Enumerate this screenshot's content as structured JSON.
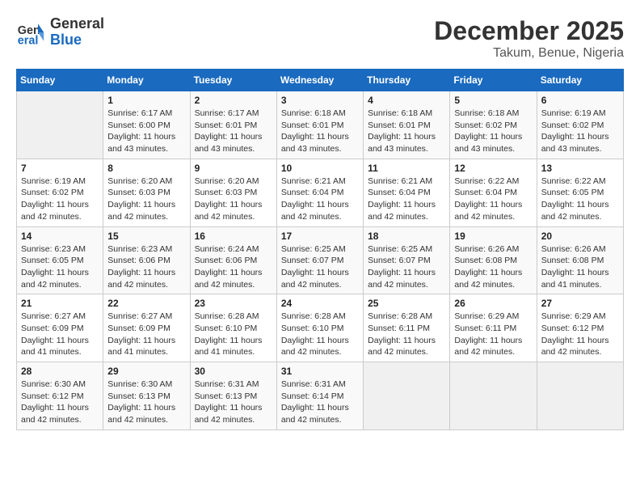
{
  "header": {
    "logo_line1": "General",
    "logo_line2": "Blue",
    "title": "December 2025",
    "subtitle": "Takum, Benue, Nigeria"
  },
  "calendar": {
    "days_of_week": [
      "Sunday",
      "Monday",
      "Tuesday",
      "Wednesday",
      "Thursday",
      "Friday",
      "Saturday"
    ],
    "weeks": [
      [
        {
          "day": "",
          "info": ""
        },
        {
          "day": "1",
          "info": "Sunrise: 6:17 AM\nSunset: 6:00 PM\nDaylight: 11 hours\nand 43 minutes."
        },
        {
          "day": "2",
          "info": "Sunrise: 6:17 AM\nSunset: 6:01 PM\nDaylight: 11 hours\nand 43 minutes."
        },
        {
          "day": "3",
          "info": "Sunrise: 6:18 AM\nSunset: 6:01 PM\nDaylight: 11 hours\nand 43 minutes."
        },
        {
          "day": "4",
          "info": "Sunrise: 6:18 AM\nSunset: 6:01 PM\nDaylight: 11 hours\nand 43 minutes."
        },
        {
          "day": "5",
          "info": "Sunrise: 6:18 AM\nSunset: 6:02 PM\nDaylight: 11 hours\nand 43 minutes."
        },
        {
          "day": "6",
          "info": "Sunrise: 6:19 AM\nSunset: 6:02 PM\nDaylight: 11 hours\nand 43 minutes."
        }
      ],
      [
        {
          "day": "7",
          "info": "Sunrise: 6:19 AM\nSunset: 6:02 PM\nDaylight: 11 hours\nand 42 minutes."
        },
        {
          "day": "8",
          "info": "Sunrise: 6:20 AM\nSunset: 6:03 PM\nDaylight: 11 hours\nand 42 minutes."
        },
        {
          "day": "9",
          "info": "Sunrise: 6:20 AM\nSunset: 6:03 PM\nDaylight: 11 hours\nand 42 minutes."
        },
        {
          "day": "10",
          "info": "Sunrise: 6:21 AM\nSunset: 6:04 PM\nDaylight: 11 hours\nand 42 minutes."
        },
        {
          "day": "11",
          "info": "Sunrise: 6:21 AM\nSunset: 6:04 PM\nDaylight: 11 hours\nand 42 minutes."
        },
        {
          "day": "12",
          "info": "Sunrise: 6:22 AM\nSunset: 6:04 PM\nDaylight: 11 hours\nand 42 minutes."
        },
        {
          "day": "13",
          "info": "Sunrise: 6:22 AM\nSunset: 6:05 PM\nDaylight: 11 hours\nand 42 minutes."
        }
      ],
      [
        {
          "day": "14",
          "info": "Sunrise: 6:23 AM\nSunset: 6:05 PM\nDaylight: 11 hours\nand 42 minutes."
        },
        {
          "day": "15",
          "info": "Sunrise: 6:23 AM\nSunset: 6:06 PM\nDaylight: 11 hours\nand 42 minutes."
        },
        {
          "day": "16",
          "info": "Sunrise: 6:24 AM\nSunset: 6:06 PM\nDaylight: 11 hours\nand 42 minutes."
        },
        {
          "day": "17",
          "info": "Sunrise: 6:25 AM\nSunset: 6:07 PM\nDaylight: 11 hours\nand 42 minutes."
        },
        {
          "day": "18",
          "info": "Sunrise: 6:25 AM\nSunset: 6:07 PM\nDaylight: 11 hours\nand 42 minutes."
        },
        {
          "day": "19",
          "info": "Sunrise: 6:26 AM\nSunset: 6:08 PM\nDaylight: 11 hours\nand 42 minutes."
        },
        {
          "day": "20",
          "info": "Sunrise: 6:26 AM\nSunset: 6:08 PM\nDaylight: 11 hours\nand 41 minutes."
        }
      ],
      [
        {
          "day": "21",
          "info": "Sunrise: 6:27 AM\nSunset: 6:09 PM\nDaylight: 11 hours\nand 41 minutes."
        },
        {
          "day": "22",
          "info": "Sunrise: 6:27 AM\nSunset: 6:09 PM\nDaylight: 11 hours\nand 41 minutes."
        },
        {
          "day": "23",
          "info": "Sunrise: 6:28 AM\nSunset: 6:10 PM\nDaylight: 11 hours\nand 41 minutes."
        },
        {
          "day": "24",
          "info": "Sunrise: 6:28 AM\nSunset: 6:10 PM\nDaylight: 11 hours\nand 42 minutes."
        },
        {
          "day": "25",
          "info": "Sunrise: 6:28 AM\nSunset: 6:11 PM\nDaylight: 11 hours\nand 42 minutes."
        },
        {
          "day": "26",
          "info": "Sunrise: 6:29 AM\nSunset: 6:11 PM\nDaylight: 11 hours\nand 42 minutes."
        },
        {
          "day": "27",
          "info": "Sunrise: 6:29 AM\nSunset: 6:12 PM\nDaylight: 11 hours\nand 42 minutes."
        }
      ],
      [
        {
          "day": "28",
          "info": "Sunrise: 6:30 AM\nSunset: 6:12 PM\nDaylight: 11 hours\nand 42 minutes."
        },
        {
          "day": "29",
          "info": "Sunrise: 6:30 AM\nSunset: 6:13 PM\nDaylight: 11 hours\nand 42 minutes."
        },
        {
          "day": "30",
          "info": "Sunrise: 6:31 AM\nSunset: 6:13 PM\nDaylight: 11 hours\nand 42 minutes."
        },
        {
          "day": "31",
          "info": "Sunrise: 6:31 AM\nSunset: 6:14 PM\nDaylight: 11 hours\nand 42 minutes."
        },
        {
          "day": "",
          "info": ""
        },
        {
          "day": "",
          "info": ""
        },
        {
          "day": "",
          "info": ""
        }
      ]
    ]
  }
}
